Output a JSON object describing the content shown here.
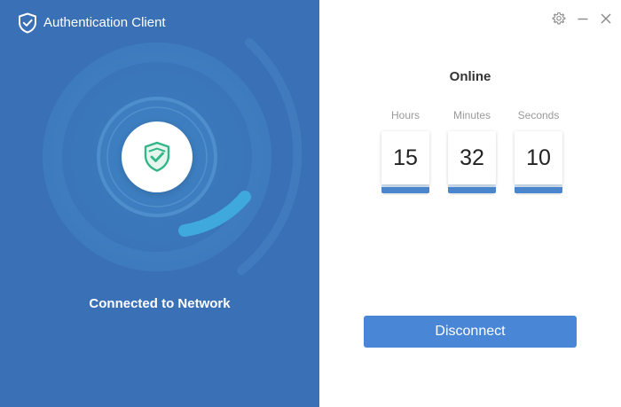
{
  "app": {
    "title": "Authentication Client",
    "network_status": "Connected to Network"
  },
  "window_controls": {
    "settings_icon": "gear-icon",
    "minimize_icon": "minimize-icon",
    "close_icon": "close-icon"
  },
  "session": {
    "status": "Online",
    "timer": [
      {
        "label": "Hours",
        "value": "15"
      },
      {
        "label": "Minutes",
        "value": "32"
      },
      {
        "label": "Seconds",
        "value": "10"
      }
    ]
  },
  "actions": {
    "disconnect_label": "Disconnect"
  },
  "colors": {
    "panel_blue": "#3a70b5",
    "ring_cyan": "#3fa8dc",
    "shield_green": "#33b68a",
    "button_blue": "#4a86d6"
  },
  "icons": {
    "brand": "shield-check-icon",
    "status": "shield-check-icon"
  }
}
